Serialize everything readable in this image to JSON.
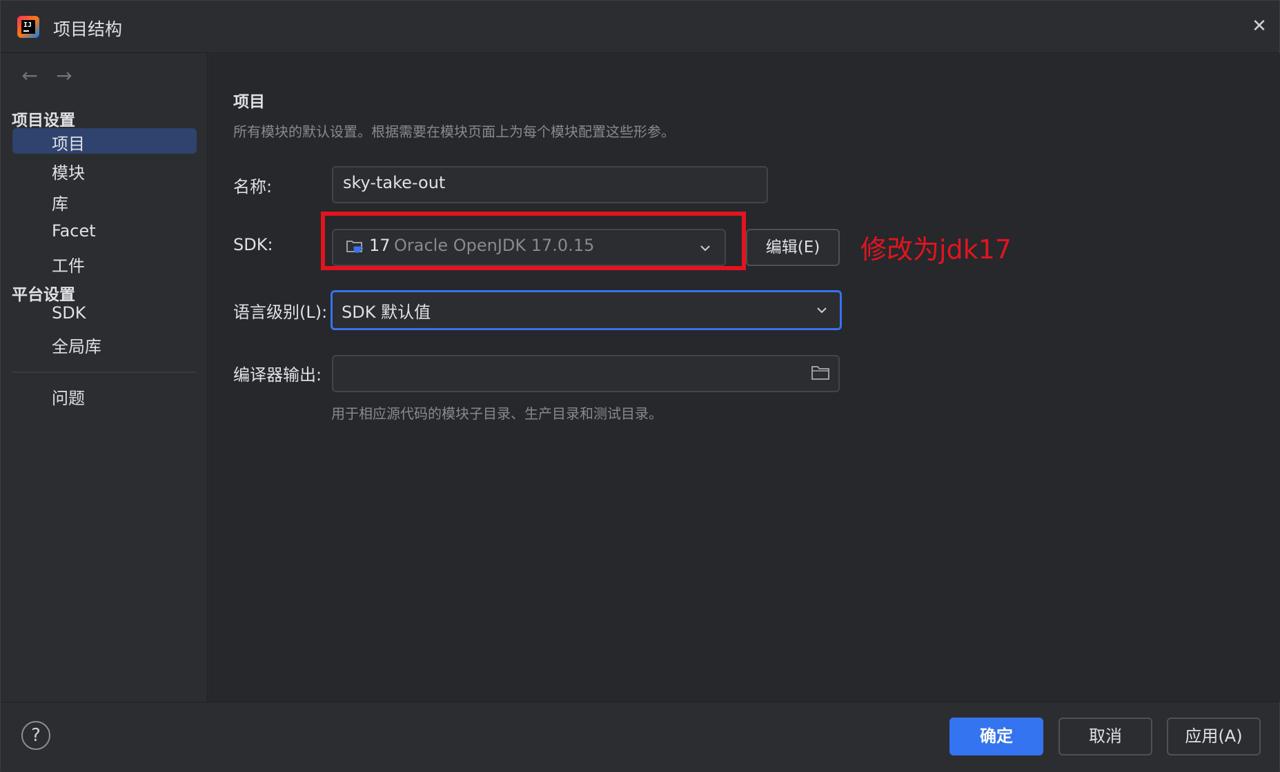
{
  "window": {
    "title": "项目结构"
  },
  "sidebar": {
    "project_settings_header": "项目设置",
    "project_settings_items": [
      "项目",
      "模块",
      "库",
      "Facet",
      "工件"
    ],
    "platform_settings_header": "平台设置",
    "platform_settings_items": [
      "SDK",
      "全局库"
    ],
    "problems_item": "问题",
    "selected": "项目"
  },
  "main": {
    "heading": "项目",
    "description": "所有模块的默认设置。根据需要在模块页面上为每个模块配置这些形参。",
    "name_label": "名称:",
    "name_value": "sky-take-out",
    "sdk_label": "SDK:",
    "sdk_version": "17",
    "sdk_name": "Oracle OpenJDK 17.0.15",
    "edit_button": "编辑(E)",
    "annotation": "修改为jdk17",
    "language_level_label": "语言级别(L):",
    "language_level_value": "SDK 默认值",
    "compiler_output_label": "编译器输出:",
    "compiler_output_value": "",
    "compiler_output_hint": "用于相应源代码的模块子目录、生产目录和测试目录。"
  },
  "footer": {
    "help": "?",
    "ok_button": "确定",
    "cancel_button": "取消",
    "apply_button": "应用(A)"
  },
  "colors": {
    "accent": "#3574f0",
    "annotation_red": "#e3141f",
    "selection": "#2e436e"
  }
}
